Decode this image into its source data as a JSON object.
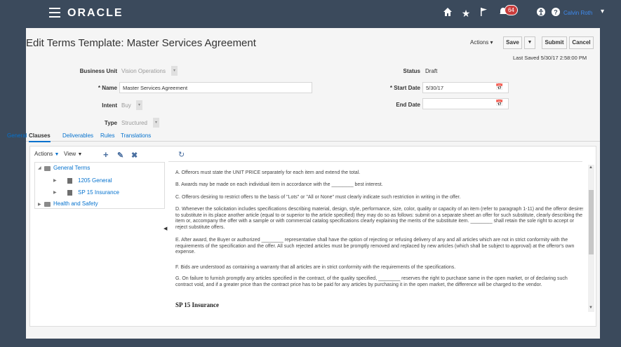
{
  "topbar": {
    "logo": "ORACLE",
    "username": "Calvin Roth",
    "notifications_count": "64",
    "icons": [
      "home-icon",
      "star-icon",
      "flag-icon",
      "bell-icon",
      "accessibility-icon",
      "help-icon"
    ]
  },
  "header": {
    "title": "Edit Terms Template: Master Services Agreement",
    "actions_label": "Actions ▾",
    "save_label": "Save",
    "save_dropdown": "▼",
    "submit_label": "Submit",
    "cancel_label": "Cancel",
    "last_saved": "Last Saved  5/30/17 2:58:00 PM"
  },
  "form": {
    "business_unit": {
      "label": "Business Unit",
      "value": "Vision Operations"
    },
    "name": {
      "label": "Name",
      "value": "Master Services Agreement"
    },
    "intent": {
      "label": "Intent",
      "value": "Buy"
    },
    "type": {
      "label": "Type",
      "value": "Structured"
    },
    "status": {
      "label": "Status",
      "value": "Draft"
    },
    "start_date": {
      "label": "Start Date",
      "value": "5/30/17"
    },
    "end_date": {
      "label": "End Date",
      "value": ""
    }
  },
  "tabs": [
    "General",
    "Clauses",
    "Deliverables",
    "Rules",
    "Translations"
  ],
  "active_tab": "Clauses",
  "tree": {
    "toolbar": {
      "actions": "Actions",
      "view": "View"
    },
    "nodes": [
      {
        "label": "General Terms",
        "level": 0,
        "expanded": true
      },
      {
        "label": "1205 General",
        "level": 1
      },
      {
        "label": "SP 15 Insurance",
        "level": 1
      },
      {
        "label": "Health and Safety",
        "level": 0,
        "expanded": false
      }
    ]
  },
  "clauses": [
    "A. Offerors must state the UNIT PRICE separately for each item and extend the total.",
    "B. Awards may be made on each individual item in accordance with the ________ best interest.",
    "C. Offerors desiring to restrict offers to the basis of \"Lots\" or \"All or None\" must clearly indicate such restriction in writing in the offer.",
    "D. Whenever the solicitation includes specifications describing material, design, style, performance, size, color, quality or capacity of an item (refer to paragraph 1-11) and the offeror desires to substitute in its place another article (equal to or superior to the article specified) they may do so as follows: submit on a separate sheet an offer for such substitute, clearly describing the item or, accompany the offer with a sample or with commercial catalog specifications clearly explaining the merits of the substitute item. ________ shall retain the sole right to accept or reject substitute offers.",
    "E. After award, the Buyer or authorized ________ representative shall have the option of rejecting or refusing delivery of any and all articles which are not in strict conformity with the requirements of the specification and the offer. All such rejected articles must be promptly removed and replaced by new articles (which shall be subject to approval) at the offeror's own expense.",
    "F. Bids are understood as containing a warranty that all articles are in strict conformity with the requirements of the specifications.",
    "G. On failure to furnish promptly any articles specified in the contract, of the quality specified, ________ reserves the right to purchase same in the open market, or of declaring such contract void, and if a greater price than the contract price has to be paid for any articles by purchasing it in the open market, the difference will be charged to the vendor."
  ],
  "section_heading": "SP 15 Insurance"
}
